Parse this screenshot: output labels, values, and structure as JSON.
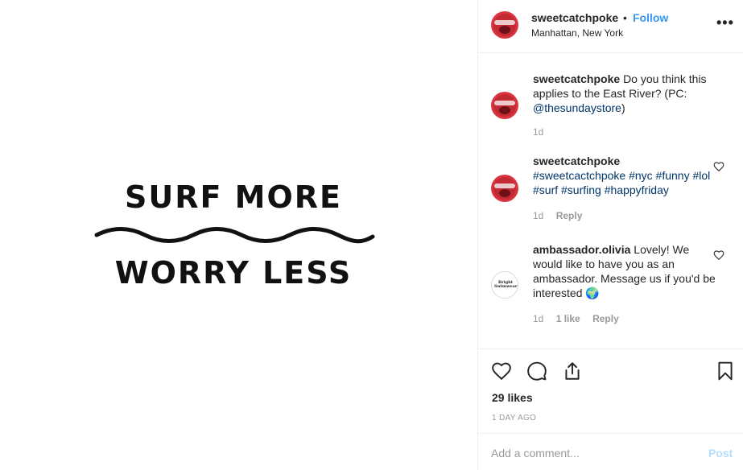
{
  "image": {
    "line1": "SURF MORE",
    "line2": "WORRY LESS"
  },
  "header": {
    "username": "sweetcatchpoke",
    "separator": "•",
    "follow_label": "Follow",
    "location": "Manhattan, New York",
    "more_icon": "ellipsis-icon",
    "more_label": "•••"
  },
  "comments": [
    {
      "username": "sweetcatchpoke",
      "text": "Do you think this applies to the East River? (PC: ",
      "mention": "@thesundaystore",
      "text_end": ")",
      "time": "1d"
    },
    {
      "username": "sweetcatchpoke",
      "hashtags": "#sweetcactchpoke #nyc #funny #lol #surf #surfing #happyfriday",
      "time": "1d",
      "reply": "Reply"
    },
    {
      "username": "ambassador.olivia",
      "text": "Lovely! We would like to have you as an ambassador. Message us if you'd be interested",
      "emoji": "🌍",
      "avatar_text": "Bright Swimwear",
      "time": "1d",
      "likes": "1 like",
      "reply": "Reply"
    }
  ],
  "actions": {
    "like_icon": "heart-icon",
    "comment_icon": "comment-icon",
    "share_icon": "share-icon",
    "save_icon": "bookmark-icon"
  },
  "likes": "29 likes",
  "timestamp": "1 DAY AGO",
  "add_comment": {
    "placeholder": "Add a comment...",
    "post_label": "Post"
  },
  "colors": {
    "link_blue": "#3897f0",
    "hashtag_navy": "#003569",
    "post_disabled": "#b2dffc",
    "muted": "#999999"
  }
}
